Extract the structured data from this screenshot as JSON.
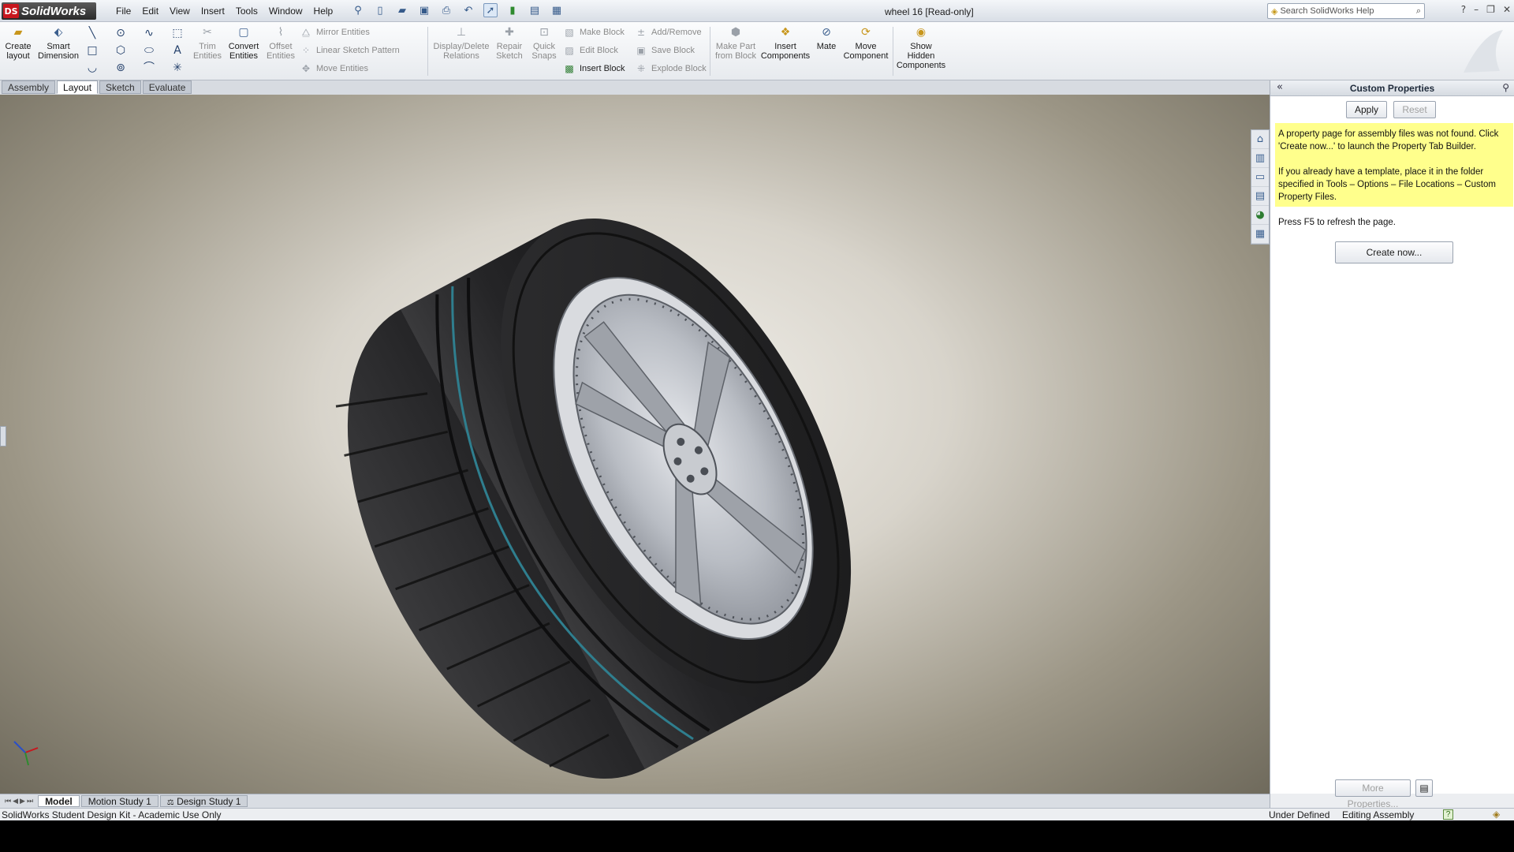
{
  "app": {
    "brand": "SolidWorks",
    "logo_mark": "DS",
    "document_title": "wheel 16 [Read-only]"
  },
  "menu": [
    "File",
    "Edit",
    "View",
    "Insert",
    "Tools",
    "Window",
    "Help"
  ],
  "help_search": {
    "placeholder": "Search SolidWorks Help"
  },
  "command_manager": {
    "create_layout": "Create layout",
    "smart_dimension": "Smart Dimension",
    "trim_entities": "Trim Entities",
    "convert_entities": "Convert Entities",
    "offset_entities": "Offset Entities",
    "mirror_entities": "Mirror Entities",
    "linear_sketch_pattern": "Linear Sketch Pattern",
    "move_entities": "Move Entities",
    "display_delete_relations": "Display/Delete Relations",
    "repair_sketch": "Repair Sketch",
    "quick_snaps": "Quick Snaps",
    "make_block": "Make Block",
    "edit_block": "Edit Block",
    "insert_block": "Insert Block",
    "add_remove": "Add/Remove",
    "save_block": "Save Block",
    "explode_block": "Explode Block",
    "make_part_from_block": "Make Part from Block",
    "insert_components": "Insert Components",
    "mate": "Mate",
    "move_component": "Move Component",
    "show_hidden_components": "Show Hidden Components"
  },
  "tabs": [
    "Assembly",
    "Layout",
    "Sketch",
    "Evaluate"
  ],
  "active_tab": "Layout",
  "task_pane": {
    "title": "Custom Properties",
    "apply": "Apply",
    "reset": "Reset",
    "notice_p1": "A property page for assembly files was not found. Click 'Create now...' to launch the Property Tab Builder.",
    "notice_p2": "If you already have a template, place it in the folder specified in Tools – Options – File Locations – Custom Property Files.",
    "notice_p3": "Press F5 to refresh the page.",
    "create_now": "Create now...",
    "more_properties": "More Properties..."
  },
  "bottom_tabs": [
    "Model",
    "Motion Study 1",
    "Design Study 1"
  ],
  "status": {
    "left": "SolidWorks Student Design Kit - Academic Use Only",
    "definition": "Under Defined",
    "mode": "Editing Assembly",
    "help": "?"
  },
  "colors": {
    "notice_bg": "#ffff8c",
    "brand_red": "#c8161d",
    "tire": "#2b2b2d",
    "rim": "#c9ccd2"
  }
}
